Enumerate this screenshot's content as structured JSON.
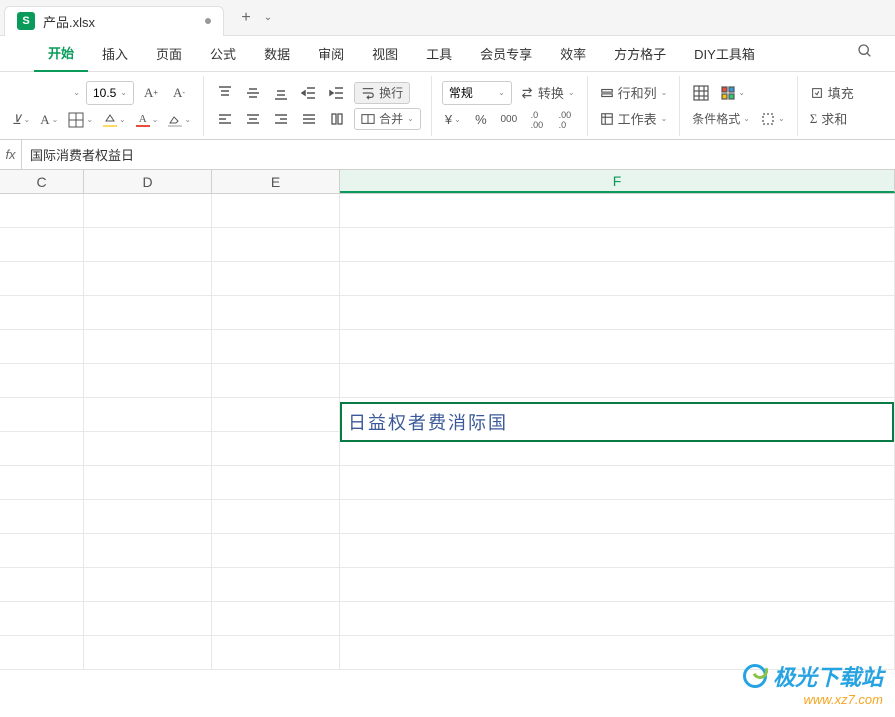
{
  "tab": {
    "icon": "S",
    "title": "产品.xlsx"
  },
  "menu": {
    "items": [
      "开始",
      "插入",
      "页面",
      "公式",
      "数据",
      "审阅",
      "视图",
      "工具",
      "会员专享",
      "效率",
      "方方格子",
      "DIY工具箱"
    ],
    "active_index": 0
  },
  "ribbon": {
    "font_size": "10.5",
    "wrap_label": "换行",
    "merge_label": "合并",
    "number_format": "常规",
    "convert_label": "转换",
    "row_col_label": "行和列",
    "worksheet_label": "工作表",
    "cond_format_label": "条件格式",
    "fill_label": "填充",
    "sum_label": "求和"
  },
  "formula": {
    "fx": "fx",
    "value": "国际消费者权益日"
  },
  "columns": [
    "C",
    "D",
    "E",
    "F"
  ],
  "selected_column_index": 3,
  "selected_cell": {
    "text": "日益权者费消际国"
  },
  "watermark": {
    "main": "极光下载站",
    "sub": "www.xz7.com"
  }
}
